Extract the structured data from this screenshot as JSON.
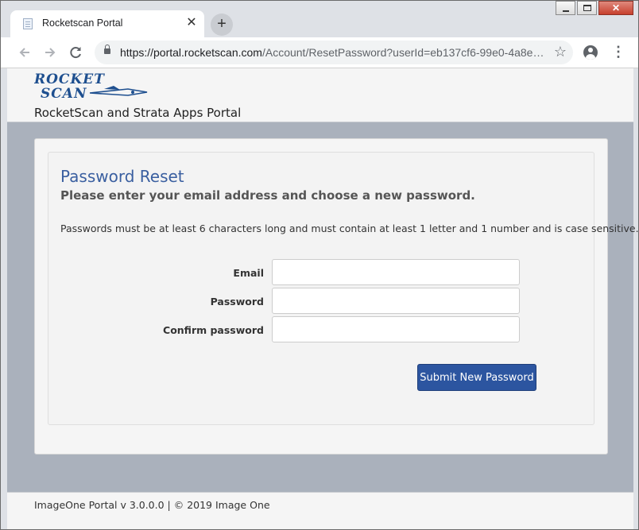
{
  "browser": {
    "tab_title": "Rocketscan Portal",
    "tab_close": "✕",
    "new_tab": "+",
    "url_host": "https://portal.rocketscan.com",
    "url_rest": "/Account/ResetPassword?userId=eb137cf6-99e0-4a8e…",
    "window_close": "✕"
  },
  "header": {
    "logo_line1": "ROCKET",
    "logo_line2": "SCAN",
    "portal_title": "RocketScan and Strata Apps Portal"
  },
  "form": {
    "heading": "Password Reset",
    "subheading": "Please enter your email address and choose a new password.",
    "note": "Passwords must be at least 6 characters long and must contain at least 1 letter and 1 number and is case sensitive.",
    "email_label": "Email",
    "email_value": "",
    "password_label": "Password",
    "password_value": "",
    "confirm_label": "Confirm password",
    "confirm_value": "",
    "submit_label": "Submit New Password"
  },
  "footer": {
    "text": "ImageOne Portal v 3.0.0.0 | © 2019 Image One"
  },
  "colors": {
    "accent": "#2c55a0",
    "heading": "#3a5fa0",
    "page_background": "#aab1bc"
  },
  "icons": [
    "page-favicon-icon",
    "close-tab-icon",
    "plus-icon",
    "minimize-icon",
    "maximize-icon",
    "close-window-icon",
    "back-arrow-icon",
    "forward-arrow-icon",
    "reload-icon",
    "lock-icon",
    "star-icon",
    "account-icon",
    "kebab-menu-icon",
    "rocket-logo-icon"
  ]
}
